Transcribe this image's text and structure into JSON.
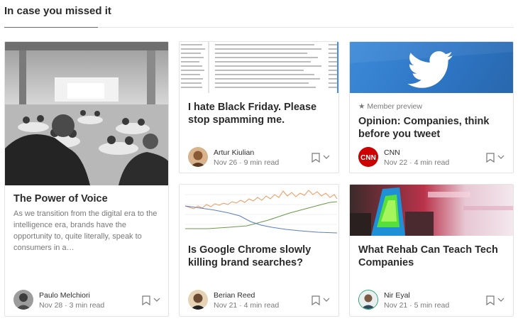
{
  "section": {
    "title": "In case you missed it"
  },
  "cards": {
    "voice": {
      "title": "The Power of Voice",
      "description": "As we transition from the digital era to the intelligence era, brands have the opportunity to, quite literally, speak to consumers in a…",
      "author": "Paulo Melchiori",
      "meta": "Nov 28 · 3 min read",
      "image_icon": "conference-photo"
    },
    "friday": {
      "title": "I hate Black Friday. Please stop spamming me.",
      "author": "Artur Kiulian",
      "meta": "Nov 26 · 9 min read",
      "image_icon": "inbox-screenshot"
    },
    "twitter": {
      "preview_label": "Member preview",
      "title": "Opinion: Companies, think before you tweet",
      "author": "CNN",
      "meta": "Nov 22 · 4 min read",
      "image_icon": "twitter-bird-logo",
      "brand_color": "#1da1f2",
      "cnn_color": "#cc0000"
    },
    "chrome": {
      "title": "Is Google Chrome slowly killing brand searches?",
      "author": "Berian Reed",
      "meta": "Nov 21 · 4 min read",
      "image_icon": "trend-chart"
    },
    "rehab": {
      "title": "What Rehab Can Teach Tech Companies",
      "author": "Nir Eyal",
      "meta": "Nov 21 · 5 min read",
      "image_icon": "vr-headset-photo"
    }
  }
}
